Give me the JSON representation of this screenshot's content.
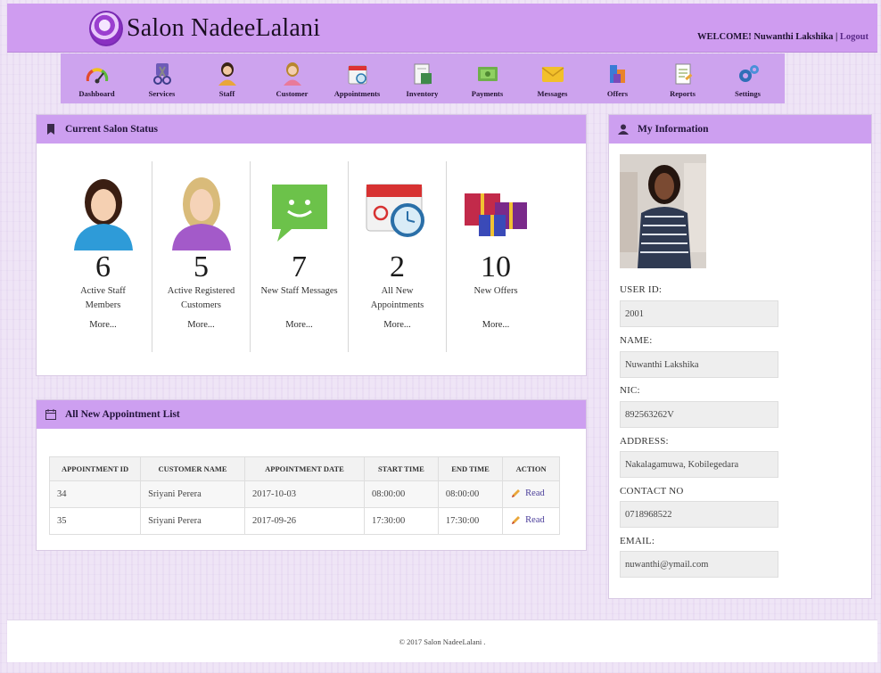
{
  "header": {
    "title": "Salon NadeeLalani",
    "welcome": "WELCOME! Nuwanthi Lakshika",
    "separator": "|",
    "logout": "Logout"
  },
  "nav": [
    {
      "label": "Dashboard",
      "icon": "gauge-icon"
    },
    {
      "label": "Services",
      "icon": "scissors-icon"
    },
    {
      "label": "Staff",
      "icon": "staff-icon"
    },
    {
      "label": "Customer",
      "icon": "customer-icon"
    },
    {
      "label": "Appointments",
      "icon": "calendar-icon"
    },
    {
      "label": "Inventory",
      "icon": "inventory-icon"
    },
    {
      "label": "Payments",
      "icon": "money-icon"
    },
    {
      "label": "Messages",
      "icon": "envelope-icon"
    },
    {
      "label": "Offers",
      "icon": "offers-icon"
    },
    {
      "label": "Reports",
      "icon": "report-icon"
    },
    {
      "label": "Settings",
      "icon": "gears-icon"
    }
  ],
  "status": {
    "title": "Current Salon Status",
    "cards": [
      {
        "count": "6",
        "label": "Active Staff Members",
        "more": "More...",
        "icon": "female-staff-icon"
      },
      {
        "count": "5",
        "label": "Active Registered Customers",
        "more": "More...",
        "icon": "customer-avatar-icon"
      },
      {
        "count": "7",
        "label": "New Staff Messages",
        "more": "More...",
        "icon": "chat-bubble-icon"
      },
      {
        "count": "2",
        "label": "All New Appointments",
        "more": "More...",
        "icon": "calendar-clock-icon"
      },
      {
        "count": "10",
        "label": "New Offers",
        "more": "More...",
        "icon": "gift-boxes-icon"
      }
    ]
  },
  "appointments": {
    "title": "All New Appointment List",
    "columns": [
      "APPOINTMENT ID",
      "CUSTOMER NAME",
      "APPOINTMENT DATE",
      "START TIME",
      "END TIME",
      "ACTION"
    ],
    "rows": [
      {
        "id": "34",
        "customer": "Sriyani Perera",
        "date": "2017-10-03",
        "start": "08:00:00",
        "end": "08:00:00",
        "action": "Read"
      },
      {
        "id": "35",
        "customer": "Sriyani Perera",
        "date": "2017-09-26",
        "start": "17:30:00",
        "end": "17:30:00",
        "action": "Read"
      }
    ]
  },
  "info": {
    "title": "My Information",
    "fields": [
      {
        "label": "USER ID:",
        "value": "2001"
      },
      {
        "label": "NAME:",
        "value": "Nuwanthi Lakshika"
      },
      {
        "label": "NIC:",
        "value": "892563262V"
      },
      {
        "label": "ADDRESS:",
        "value": "Nakalagamuwa, Kobilegedara"
      },
      {
        "label": "CONTACT NO",
        "value": "0718968522"
      },
      {
        "label": "EMAIL:",
        "value": "nuwanthi@ymail.com"
      }
    ]
  },
  "footer": {
    "text": "© 2017 Salon NadeeLalani ."
  },
  "colors": {
    "header": "#cf9cf0",
    "nav": "#cda3ee",
    "panel_head": "#cd9ff0"
  }
}
